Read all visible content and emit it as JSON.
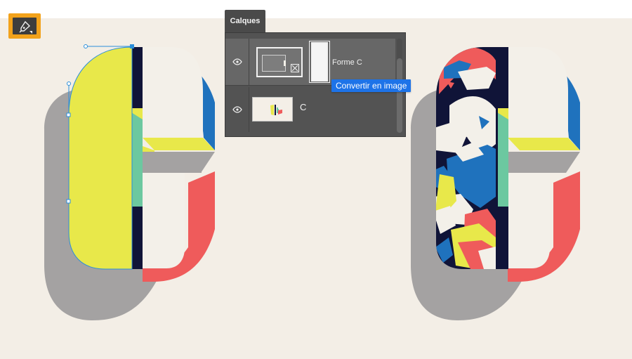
{
  "tool": {
    "active": "pen-tool",
    "icon": "pen-icon",
    "accent_color": "#f2a21b"
  },
  "panel": {
    "tab_label": "Calques",
    "layers": [
      {
        "name": "Forme C",
        "selected": true,
        "visible": true
      },
      {
        "name": "C",
        "selected": false,
        "visible": true
      }
    ]
  },
  "tooltip": {
    "text": "Convertir en image"
  },
  "colors": {
    "canvas": "#f3eee6",
    "yellow": "#e8e84a",
    "navy": "#101438",
    "green": "#6cc8a0",
    "blue": "#1f72bd",
    "red": "#ef5b5b",
    "shadow": "#a4a2a2",
    "cream": "#f3f0e9",
    "tooltip": "#1d73e8"
  }
}
